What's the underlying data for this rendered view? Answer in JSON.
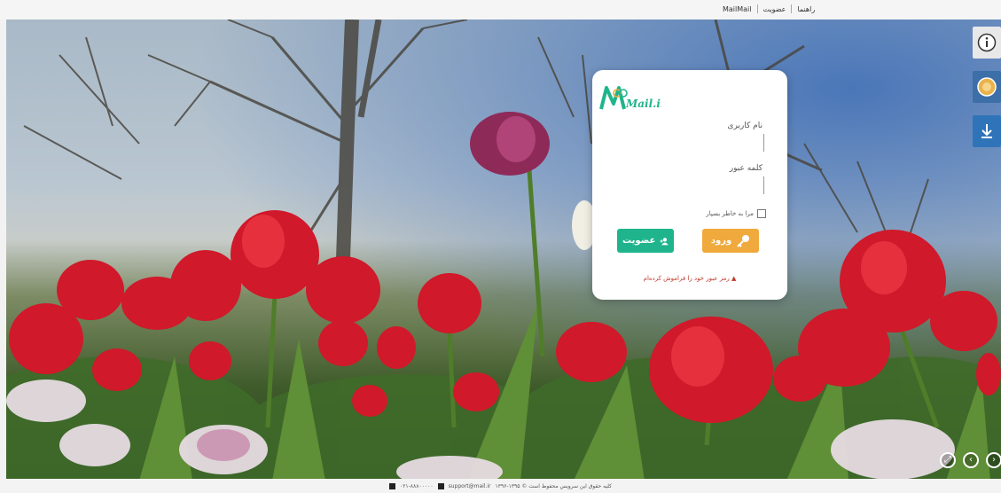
{
  "topbar": {
    "brand": "MailMail",
    "register_link": "عضویت",
    "help_link": "راهنما"
  },
  "login": {
    "logo_text": "Mail.ir",
    "username_label": "نام کاربری",
    "username_value": "",
    "password_label": "کلمه عبور",
    "password_value": "",
    "remember_label": "مرا به خاطر بسپار",
    "login_button": "ورود",
    "register_button": "عضویت",
    "forgot_text": "رمز عبور خود را فراموش کرده‌ام",
    "brand_color": "#20b48c",
    "accent_color": "#f0a93c"
  },
  "side_tools": {
    "info_icon": "info-icon",
    "theme_icon": "theme-icon",
    "download_icon": "download-icon"
  },
  "controls": [
    "fullscreen-icon",
    "prev-icon",
    "next-icon"
  ],
  "footer": {
    "support_text": "support@mail.ir",
    "phone_text": "۰۲۱-۸۸۸۰۰۰۰۰",
    "copyright": "کلیه حقوق این سرویس محفوظ است © ۱۳۹۵-۱۳۹۶"
  }
}
